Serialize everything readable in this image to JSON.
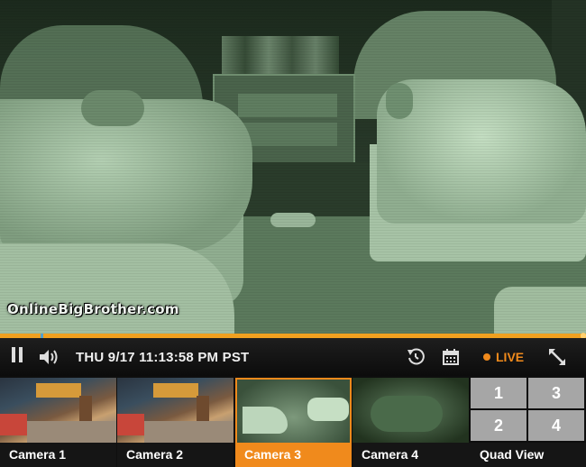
{
  "player": {
    "watermark": "OnlineBigBrother.com",
    "progress_fraction": 0.998,
    "timestamp": "THU 9/17 11:13:58 PM PST",
    "live_label": "LIVE",
    "icons": {
      "pause": "pause-icon",
      "volume": "speaker-icon",
      "replay": "replay-icon",
      "calendar": "calendar-icon",
      "fullscreen": "fullscreen-icon"
    }
  },
  "cameras": [
    {
      "label": "Camera 1",
      "active": false
    },
    {
      "label": "Camera 2",
      "active": false
    },
    {
      "label": "Camera 3",
      "active": true
    },
    {
      "label": "Camera 4",
      "active": false
    }
  ],
  "quad_view": {
    "label": "Quad View",
    "cells": [
      "1",
      "3",
      "2",
      "4"
    ]
  },
  "colors": {
    "accent": "#f08a1c",
    "progress": "#f0a020",
    "quad_cell": "#a6a6a6"
  }
}
